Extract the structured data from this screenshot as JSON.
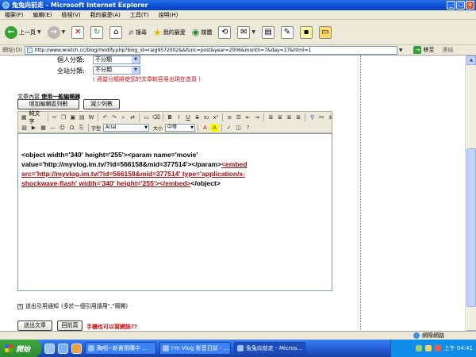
{
  "window": {
    "title": "兔兔向前走 - Microsoft Internet Explorer"
  },
  "menu": [
    "檔案(F)",
    "編輯(E)",
    "檢視(V)",
    "我的最愛(A)",
    "工具(T)",
    "說明(H)"
  ],
  "toolbar": {
    "back": "上一頁",
    "search": "搜尋",
    "favorites": "我的最愛",
    "media": "媒體"
  },
  "address": {
    "label": "網址(D)",
    "url": "http://www.wretch.cc/blog/modify.php?blog_id=raig9572002&&func=post&year=2006&month=7&day=17&html=1",
    "go": "移至",
    "links": "連結"
  },
  "form": {
    "personal_category_label": "個人分類:",
    "personal_category_value": "不分類",
    "site_category_label": "全站分類:",
    "site_category_value": "不分類",
    "site_category_note": "( 適當分類將使您的文章較容易出現在首頁 )",
    "content_label": "文章內容",
    "content_mode": "使用一般編輯器",
    "add_rows": "增加編輯區列數",
    "remove_rows": "減少列數"
  },
  "editor_toolbar": {
    "mode_button": "純文字",
    "font_label": "字型",
    "font_value": "Arial",
    "size_label": "大小",
    "size_value": "中等"
  },
  "editor": {
    "line1": "<object width='340' height='255'><param name='movie'",
    "line2_plain": "value='http://myvlog.im.tv/?id=566158&mid=377514'></param>",
    "line2_embed": "<embed",
    "line3": "src='http://myvlog.im.tv/?id=566158&mid=377514' type='application/x-",
    "line4_embed": "shockwave-flash' width='340' height='255'></embed>",
    "line4_plain": "</object>"
  },
  "trackback": {
    "label": "送出引用通知",
    "hint": "(多於一個引用請用\",\"隔開)"
  },
  "actions": {
    "submit": "送出文章",
    "back": "回前頁",
    "note": "手機也可以寫網誌??"
  },
  "statusbar": {
    "zone": "網際網路"
  },
  "taskbar": {
    "start": "開始",
    "tasks": [
      "胸咽~新書預購中 ...",
      "I'm Vlog 影音日誌 - ...",
      "兔兔向前走 - Micros..."
    ],
    "clock": "上午 04:41"
  },
  "colors": {
    "accent": "#245edb",
    "warning": "#d01010",
    "embed": "#a01010"
  }
}
